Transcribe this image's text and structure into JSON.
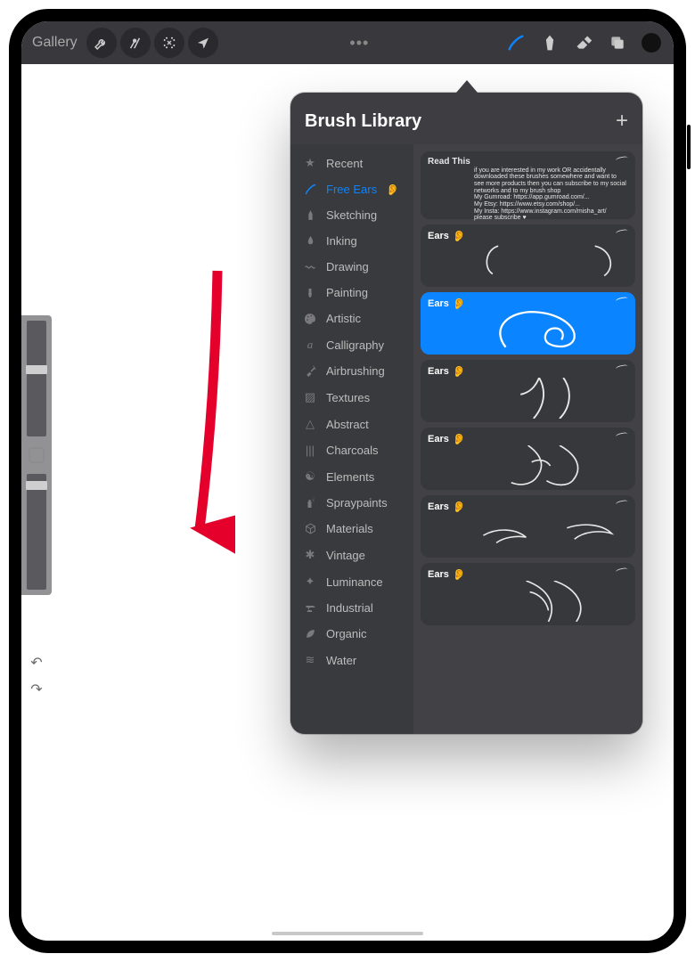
{
  "toolbar": {
    "gallery_label": "Gallery"
  },
  "popup": {
    "title": "Brush Library"
  },
  "categories": [
    {
      "icon": "★",
      "label": "Recent"
    },
    {
      "icon": "brush",
      "label": "Free Ears",
      "emoji": "👂",
      "selected": true
    },
    {
      "icon": "✒",
      "label": "Sketching"
    },
    {
      "icon": "nib",
      "label": "Inking"
    },
    {
      "icon": "∿",
      "label": "Drawing"
    },
    {
      "icon": "🖌",
      "label": "Painting"
    },
    {
      "icon": "🎨",
      "label": "Artistic"
    },
    {
      "icon": "𝒶",
      "label": "Calligraphy"
    },
    {
      "icon": "spray",
      "label": "Airbrushing"
    },
    {
      "icon": "▨",
      "label": "Textures"
    },
    {
      "icon": "△",
      "label": "Abstract"
    },
    {
      "icon": "|||",
      "label": "Charcoals"
    },
    {
      "icon": "☯",
      "label": "Elements"
    },
    {
      "icon": "spray2",
      "label": "Spraypaints"
    },
    {
      "icon": "⬡",
      "label": "Materials"
    },
    {
      "icon": "✱",
      "label": "Vintage"
    },
    {
      "icon": "✦",
      "label": "Luminance"
    },
    {
      "icon": "🔨",
      "label": "Industrial"
    },
    {
      "icon": "🍃",
      "label": "Organic"
    },
    {
      "icon": "≋",
      "label": "Water"
    }
  ],
  "brushes": [
    {
      "name": "Read This",
      "desc": "if you are interested in my work OR accidentally downloaded these brushes somewhere and want to see more products then you can subscribe to my social networks and to my brush shop\nMy Gumroad: https://app.gumroad.com/...\nMy Etsy: https://www.etsy.com/shop/...\nMy Insta: https://www.instagram.com/misha_art/\nplease subscribe ♥"
    },
    {
      "name": "Ears",
      "emoji": "👂"
    },
    {
      "name": "Ears",
      "emoji": "👂",
      "selected": true
    },
    {
      "name": "Ears",
      "emoji": "👂"
    },
    {
      "name": "Ears",
      "emoji": "👂"
    },
    {
      "name": "Ears",
      "emoji": "👂"
    },
    {
      "name": "Ears",
      "emoji": "👂"
    }
  ]
}
